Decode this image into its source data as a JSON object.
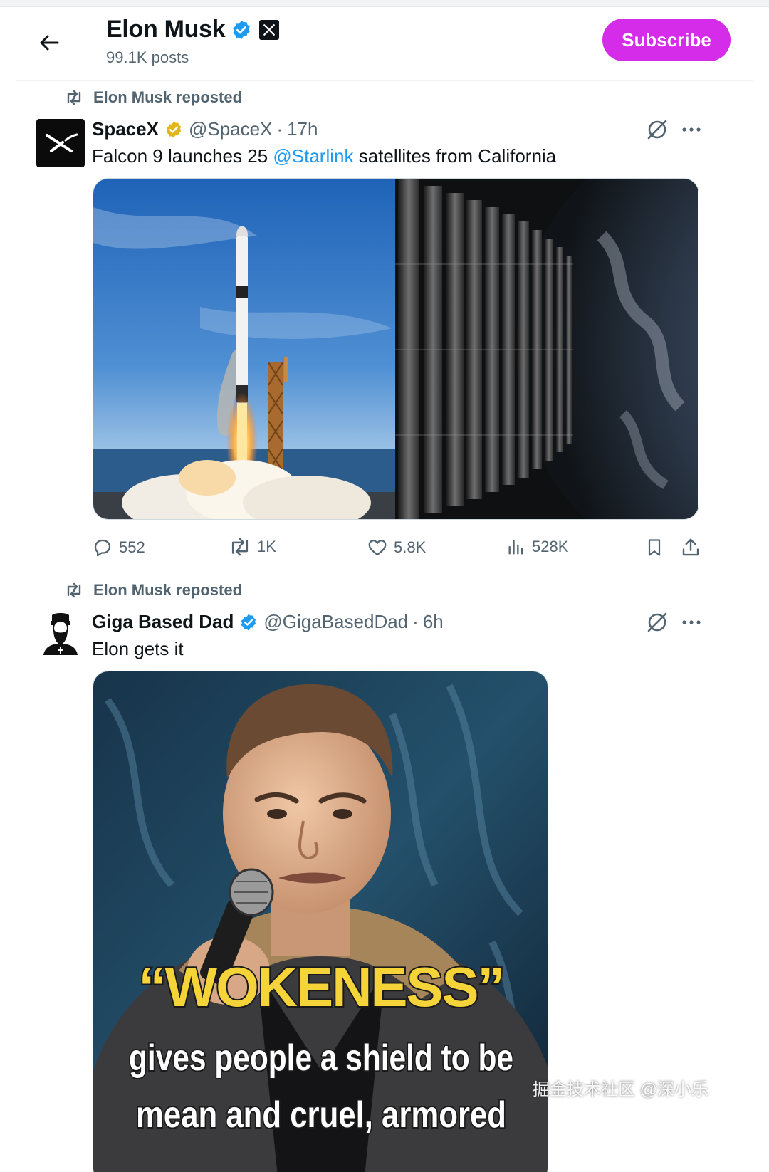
{
  "header": {
    "name": "Elon Musk",
    "posts": "99.1K posts",
    "subscribe_label": "Subscribe"
  },
  "colors": {
    "subscribe": "#d42ce8",
    "verified_blue": "#1d9bf0",
    "verified_gold": "#e2b719",
    "mention": "#1d9bf0",
    "secondary_text": "#536471"
  },
  "posts": [
    {
      "repost_label": "Elon Musk reposted",
      "author": "SpaceX",
      "verified": "gold",
      "handle": "@SpaceX",
      "time": "17h",
      "text_before": "Falcon 9 launches 25 ",
      "mention": "@Starlink",
      "text_after": " satellites from California",
      "media": [
        "rocket-launch-image",
        "starlink-satellites-image"
      ],
      "replies": "552",
      "reposts": "1K",
      "likes": "5.8K",
      "views": "528K"
    },
    {
      "repost_label": "Elon Musk reposted",
      "author": "Giga Based Dad",
      "verified": "blue",
      "handle": "@GigaBasedDad",
      "time": "6h",
      "text": "Elon gets it",
      "meme": {
        "headline": "“WOKENESS”",
        "line1": "gives people a shield to be",
        "line2": "mean and cruel, armored"
      }
    }
  ],
  "watermark": "掘金技术社区 @深小乐",
  "icons": [
    "back-arrow-icon",
    "verified-icon",
    "x-logo-icon",
    "repost-icon",
    "grok-icon",
    "more-icon",
    "reply-icon",
    "like-icon",
    "views-icon",
    "bookmark-icon",
    "share-icon"
  ]
}
